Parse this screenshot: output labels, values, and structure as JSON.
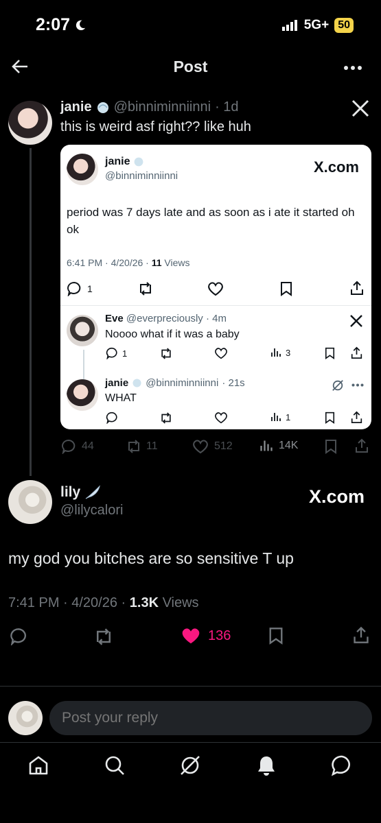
{
  "status_bar": {
    "time": "2:07",
    "network": "5G+",
    "battery": "50"
  },
  "header": {
    "title": "Post"
  },
  "quoted_post": {
    "author_name": "janie",
    "author_handle": "@binniminniinni",
    "time": "· 1d",
    "text": "this is weird asf right?? like huh"
  },
  "card": {
    "brand": "X.com",
    "original": {
      "author_name": "janie",
      "author_handle": "@binniminniinni",
      "text": "period was 7 days late and as soon as i ate it started oh ok",
      "timestamp": "6:41 PM · 4/20/26 · ",
      "views_count": "11",
      "views_label": " Views",
      "reply_count": "1"
    },
    "reply1": {
      "author_name": "Eve",
      "author_handle": "@everpreciously",
      "time": "· 4m",
      "text": "Noooo what if it was a baby",
      "reply_count": "1",
      "view_count": "3"
    },
    "reply2": {
      "author_name": "janie",
      "author_handle": "@binniminniinni",
      "time": "· 21s",
      "text": "WHAT",
      "view_count": "1"
    }
  },
  "quoted_stats": {
    "replies": "44",
    "reposts": "11",
    "likes": "512",
    "views": "14K"
  },
  "main_post": {
    "author_name": "lily",
    "author_handle": "@lilycalori",
    "brand": "X.com",
    "text": "my god you bitches are so sensitive T up",
    "timestamp": "7:41 PM · 4/20/26 · ",
    "views_count": "1.3K",
    "views_label": " Views",
    "likes": "136"
  },
  "composer": {
    "placeholder": "Post your reply"
  },
  "colors": {
    "like_pink": "#f91880",
    "background": "#000000",
    "muted": "#71767b"
  }
}
